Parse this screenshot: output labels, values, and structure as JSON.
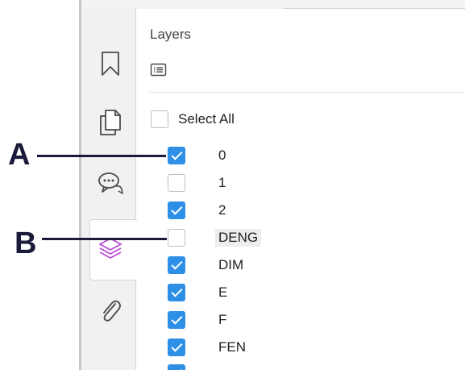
{
  "panel": {
    "title": "Layers",
    "select_all_label": "Select All",
    "select_all_checked": false
  },
  "layers": [
    {
      "name": "0",
      "checked": true
    },
    {
      "name": "1",
      "checked": false
    },
    {
      "name": "2",
      "checked": true
    },
    {
      "name": "DENG",
      "checked": false,
      "highlighted": true
    },
    {
      "name": "DIM",
      "checked": true
    },
    {
      "name": "E",
      "checked": true
    },
    {
      "name": "F",
      "checked": true
    },
    {
      "name": "FEN",
      "checked": true
    }
  ],
  "rail_icons": [
    "bookmark-icon",
    "pages-icon",
    "comments-icon",
    "layers-icon",
    "attachment-icon"
  ],
  "callouts": {
    "a": "A",
    "b": "B"
  },
  "colors": {
    "checkbox_checked": "#2d8fe6",
    "layers_icon_active": "#b94bd6",
    "callout": "#1a1a3a"
  }
}
